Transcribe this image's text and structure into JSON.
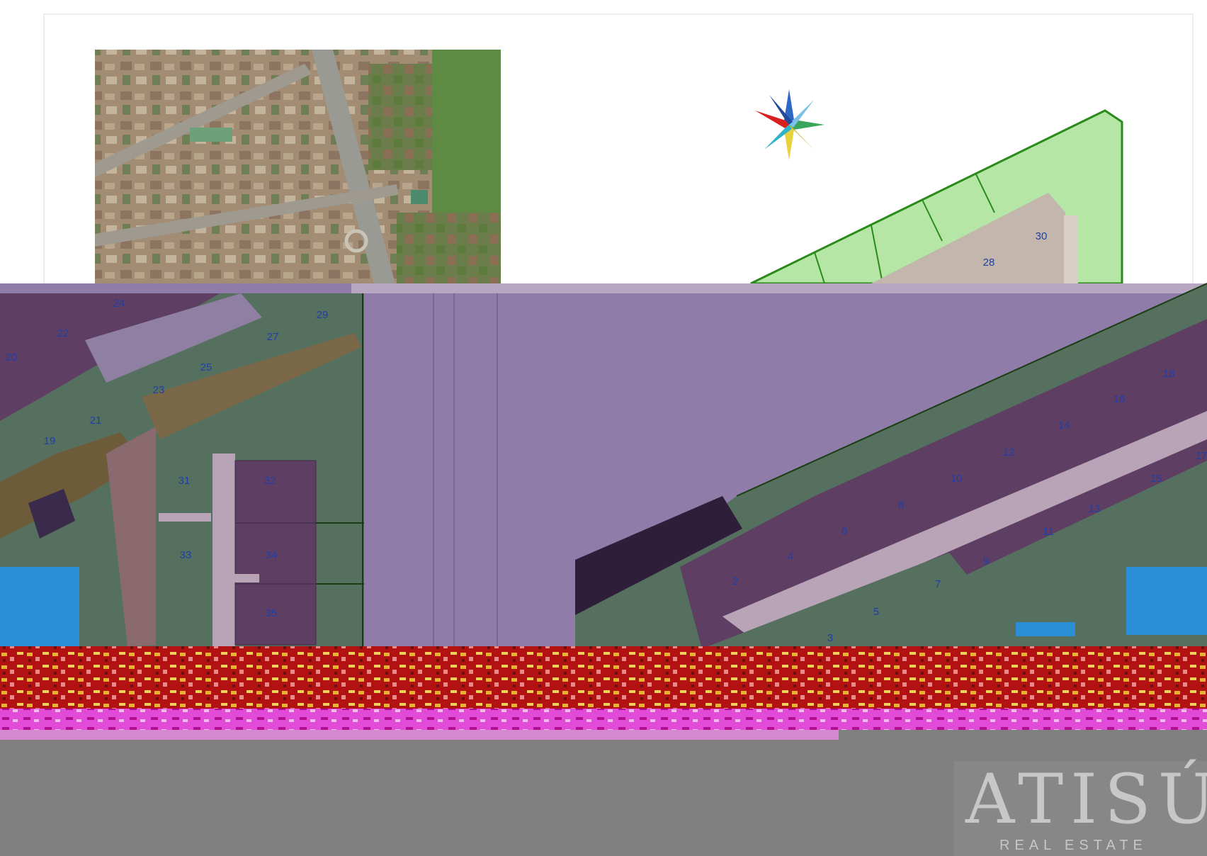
{
  "plots": {
    "p2": "2",
    "p3": "3",
    "p4": "4",
    "p5": "5",
    "p6": "6",
    "p7": "7",
    "p8": "8",
    "p9": "9",
    "p10": "10",
    "p11": "11",
    "p12": "12",
    "p13": "13",
    "p14": "14",
    "p15": "15",
    "p16": "16",
    "p17": "17",
    "p18": "18",
    "p19": "19",
    "p20": "20",
    "p21": "21",
    "p22": "22",
    "p23": "23",
    "p24": "24",
    "p25": "25",
    "p27": "27",
    "p28": "28",
    "p29": "29",
    "p30": "30",
    "p31": "31",
    "p32": "32",
    "p33": "33",
    "p34": "34",
    "p35": "35"
  },
  "watermark": {
    "logo": "ATISÚ",
    "tagline": "REAL ESTATE"
  },
  "colors": {
    "plot_fill": "#5e3f63",
    "garden": "#55705e",
    "street": "#8f7ca8",
    "lot_outline": "#2a8a1a",
    "lot_fill": "#b6e6a6",
    "label": "#1f3fa8",
    "noise_band": "#b01010",
    "pool": "#2b8fd8"
  }
}
